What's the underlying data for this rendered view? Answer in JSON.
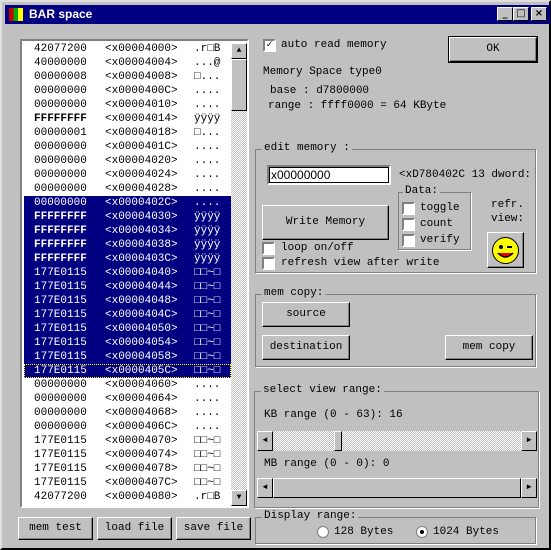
{
  "window": {
    "title": "BAR space",
    "buttons": {
      "minimize": "_",
      "maximize": "□",
      "close": "×"
    }
  },
  "memory_list": {
    "rows": [
      [
        "42077200",
        "<x00004000>",
        ".r□B"
      ],
      [
        "40000000",
        "<x00004004>",
        "...@"
      ],
      [
        "00000008",
        "<x00004008>",
        "□..."
      ],
      [
        "00000000",
        "<x0000400C>",
        "...."
      ],
      [
        "00000000",
        "<x00004010>",
        "...."
      ],
      [
        "FFFFFFFF",
        "<x00004014>",
        "ÿÿÿÿ"
      ],
      [
        "00000001",
        "<x00004018>",
        "□..."
      ],
      [
        "00000000",
        "<x0000401C>",
        "...."
      ],
      [
        "00000000",
        "<x00004020>",
        "...."
      ],
      [
        "00000000",
        "<x00004024>",
        "...."
      ],
      [
        "00000000",
        "<x00004028>",
        "...."
      ],
      [
        "00000000",
        "<x0000402C>",
        "...."
      ],
      [
        "FFFFFFFF",
        "<x00004030>",
        "ÿÿÿÿ"
      ],
      [
        "FFFFFFFF",
        "<x00004034>",
        "ÿÿÿÿ"
      ],
      [
        "FFFFFFFF",
        "<x00004038>",
        "ÿÿÿÿ"
      ],
      [
        "FFFFFFFF",
        "<x0000403C>",
        "ÿÿÿÿ"
      ],
      [
        "177E0115",
        "<x00004040>",
        "□□~□"
      ],
      [
        "177E0115",
        "<x00004044>",
        "□□~□"
      ],
      [
        "177E0115",
        "<x00004048>",
        "□□~□"
      ],
      [
        "177E0115",
        "<x0000404C>",
        "□□~□"
      ],
      [
        "177E0115",
        "<x00004050>",
        "□□~□"
      ],
      [
        "177E0115",
        "<x00004054>",
        "□□~□"
      ],
      [
        "177E0115",
        "<x00004058>",
        "□□~□"
      ],
      [
        "177E0115",
        "<x0000405C>",
        "□□~□"
      ],
      [
        "00000000",
        "<x00004060>",
        "...."
      ],
      [
        "00000000",
        "<x00004064>",
        "...."
      ],
      [
        "00000000",
        "<x00004068>",
        "...."
      ],
      [
        "00000000",
        "<x0000406C>",
        "...."
      ],
      [
        "177E0115",
        "<x00004070>",
        "□□~□"
      ],
      [
        "177E0115",
        "<x00004074>",
        "□□~□"
      ],
      [
        "177E0115",
        "<x00004078>",
        "□□~□"
      ],
      [
        "177E0115",
        "<x0000407C>",
        "□□~□"
      ],
      [
        "42077200",
        "<x00004080>",
        ".r□B"
      ]
    ],
    "selected_from": 11,
    "selected_to": 23,
    "focused": 23
  },
  "bottom_buttons": {
    "mem_test": "mem test",
    "load_file": "load file",
    "save_file": "save file"
  },
  "auto_read": {
    "label": "auto read memory",
    "checked": true,
    "mark": "✓"
  },
  "ok": "OK",
  "info": {
    "type": "Memory Space type0",
    "base": "base : d7800000",
    "range": "range : ffff0000 = 64 KByte"
  },
  "edit_memory": {
    "title": "edit memory :",
    "value": "x00000000",
    "address_info": "<xD780402C 13 dword:",
    "write": "Write Memory",
    "loop": "loop on/off",
    "refresh": "refresh view after write",
    "data_title": "Data:",
    "toggle": "toggle",
    "count": "count",
    "verify": "verify",
    "refr1": "refr.",
    "refr2": "view:"
  },
  "mem_copy": {
    "title": "mem copy:",
    "source": "source",
    "destination": "destination",
    "copy": "mem copy"
  },
  "view_range": {
    "title": "select view range:",
    "kb_label": "KB range (0 - 63): 16",
    "kb_value": 16,
    "kb_max": 63,
    "mb_label": "MB range (0 - 0): 0",
    "mb_value": 0,
    "left": "◄",
    "right": "►"
  },
  "display_range": {
    "title": "Display range:",
    "opt128": "128 Bytes",
    "opt1024": "1024 Bytes",
    "selected": "1024 Bytes"
  },
  "colors": {
    "titlebar": "#000080",
    "selection": "#000080",
    "face": "#c0c0c0"
  }
}
